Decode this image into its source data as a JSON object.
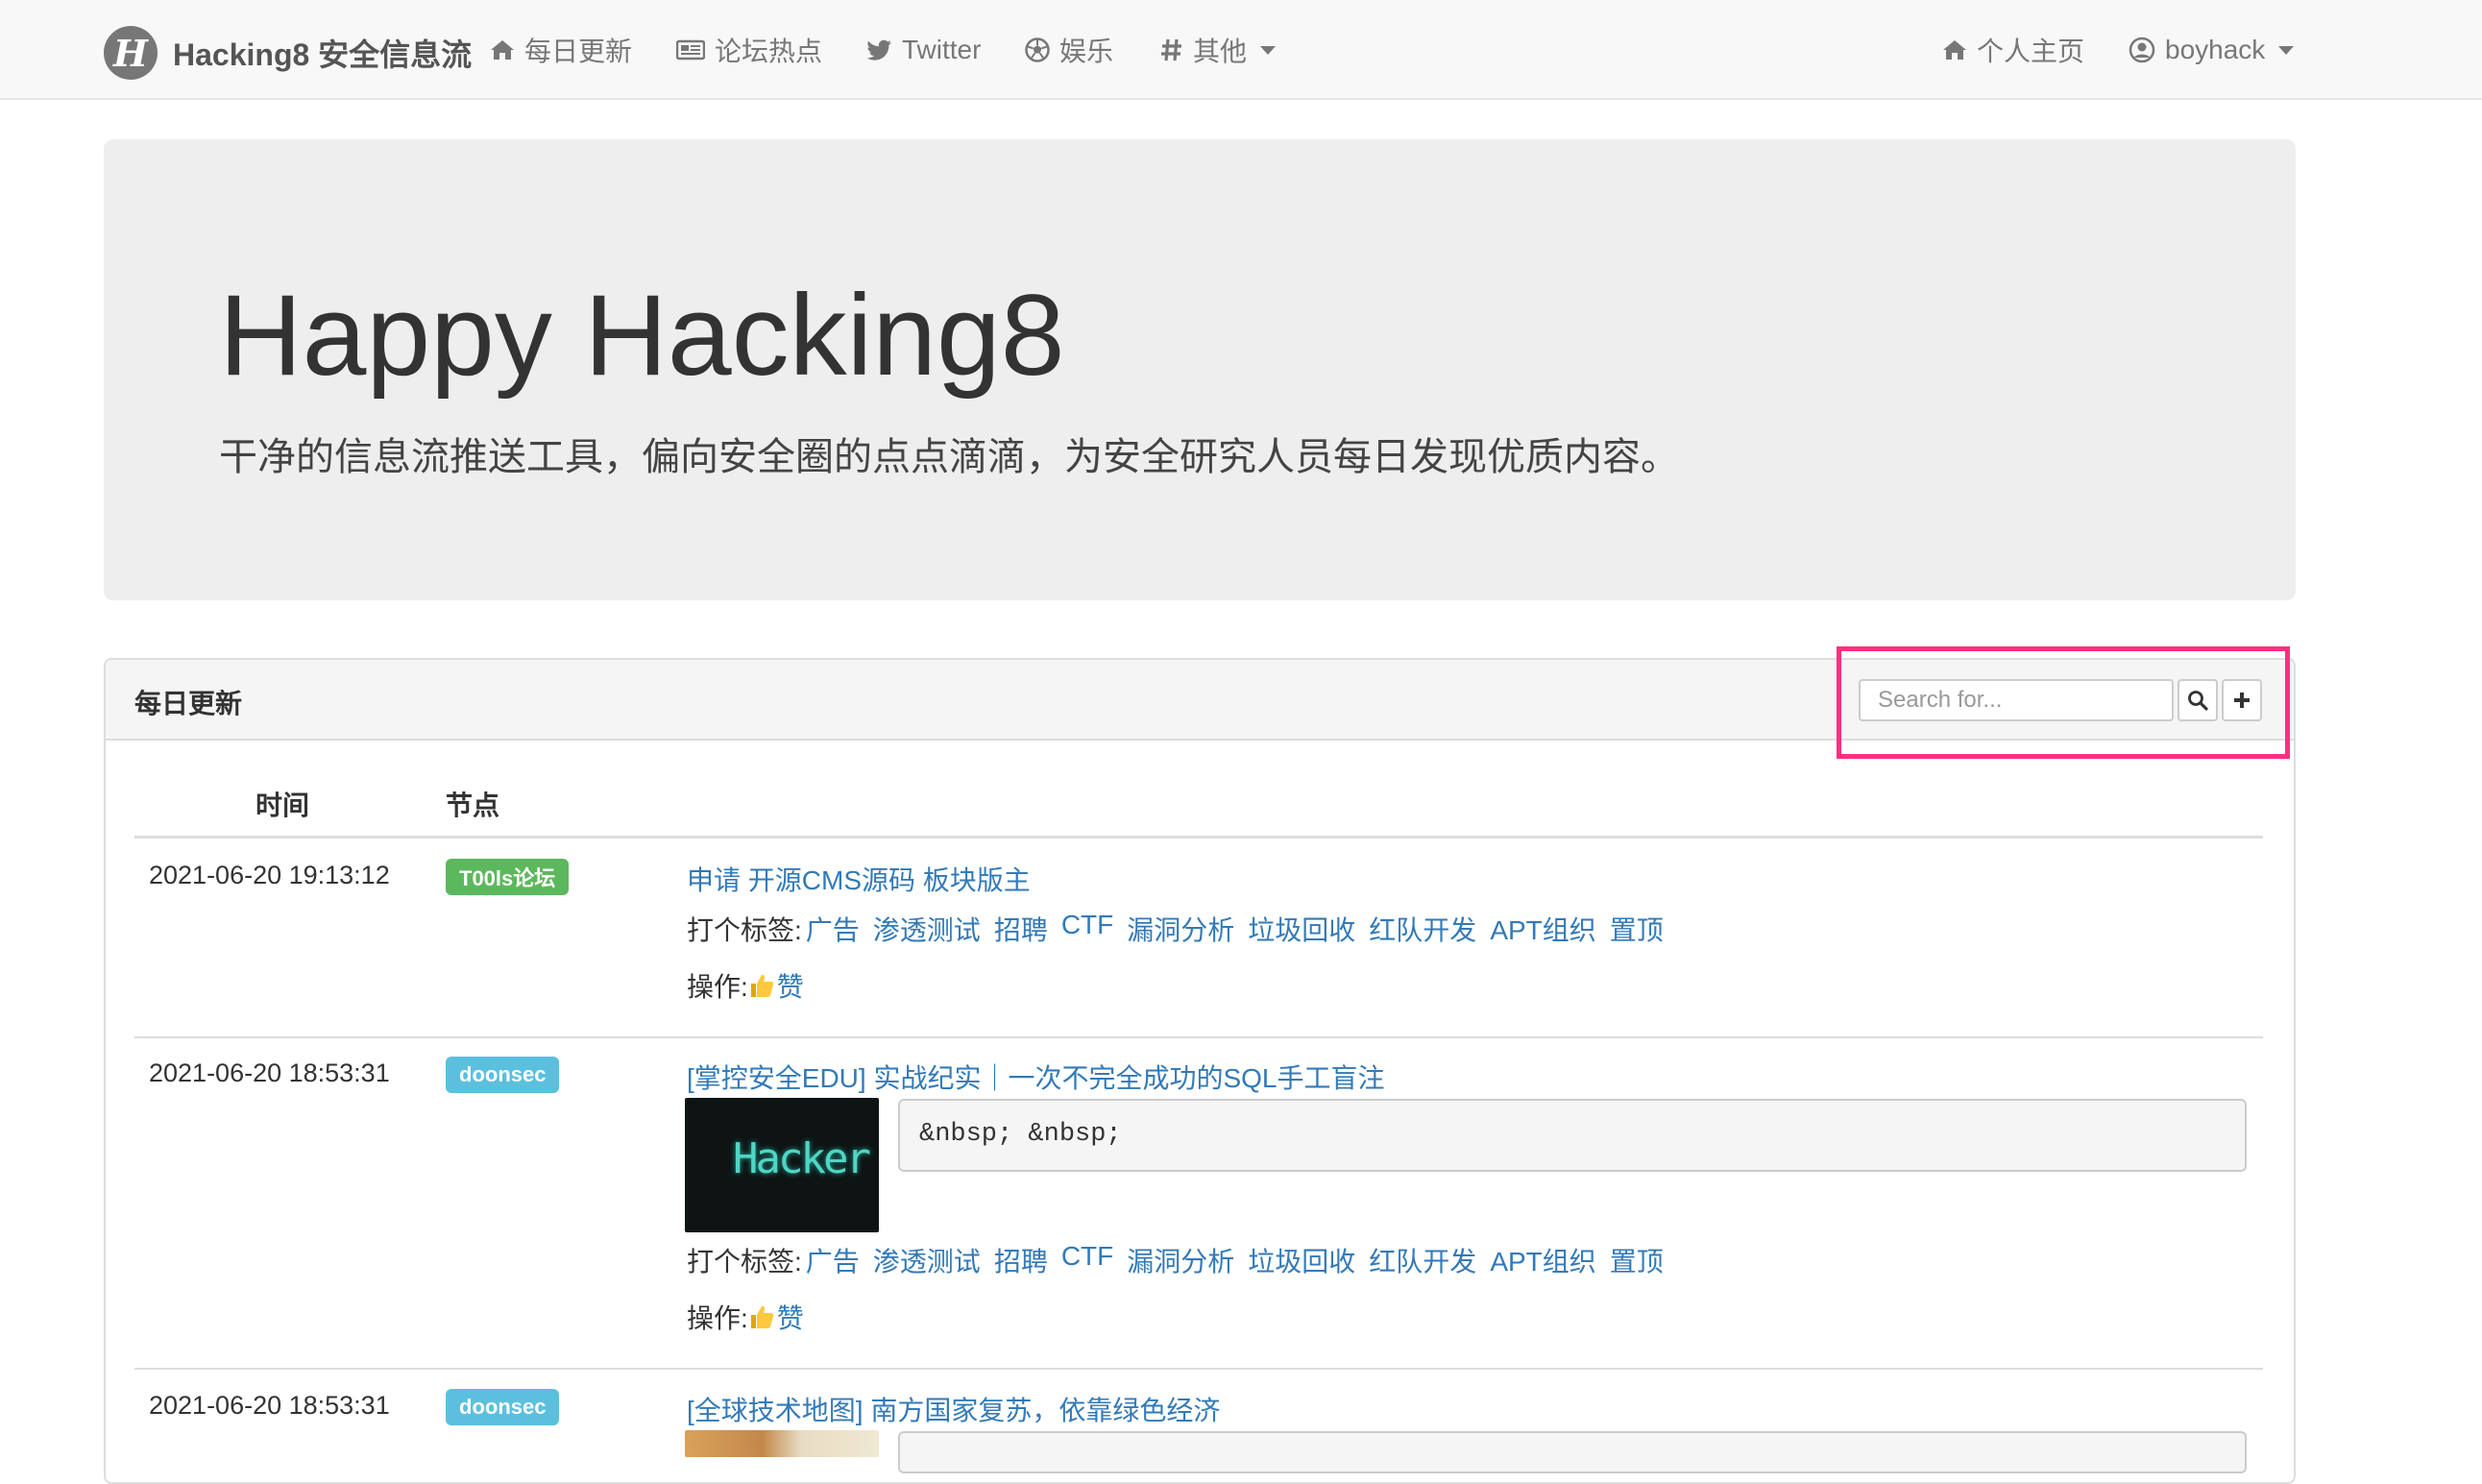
{
  "navbar": {
    "brand": "Hacking8 安全信息流",
    "items": [
      {
        "label": "每日更新",
        "icon": "home-icon"
      },
      {
        "label": "论坛热点",
        "icon": "newspaper-icon"
      },
      {
        "label": "Twitter",
        "icon": "twitter-icon"
      },
      {
        "label": "娱乐",
        "icon": "soccer-ball-icon"
      },
      {
        "label": "其他",
        "icon": "hashtag-icon"
      }
    ],
    "right": {
      "home_label": "个人主页",
      "user_label": "boyhack"
    }
  },
  "jumbotron": {
    "title": "Happy Hacking8",
    "subtitle": "干净的信息流推送工具，偏向安全圈的点点滴滴，为安全研究人员每日发现优质内容。"
  },
  "panel": {
    "title": "每日更新",
    "search_placeholder": "Search for..."
  },
  "table": {
    "headers": {
      "time": "时间",
      "node": "节点"
    },
    "tags_label": "打个标签:",
    "tags": [
      "广告",
      "渗透测试",
      "招聘",
      "CTF",
      "漏洞分析",
      "垃圾回收",
      "红队开发",
      "APT组织",
      "置顶"
    ],
    "ops_label": "操作:",
    "like_label": "赞",
    "rows": [
      {
        "time": "2021-06-20 19:13:12",
        "node": "T00ls论坛",
        "title": "申请 开源CMS源码 板块版主"
      },
      {
        "time": "2021-06-20 18:53:31",
        "node": "doonsec",
        "title": "[掌控安全EDU] 实战纪实｜一次不完全成功的SQL手工盲注",
        "image_text": "Hacker",
        "snippet": "&nbsp; &nbsp;"
      },
      {
        "time": "2021-06-20 18:53:31",
        "node": "doonsec",
        "title": "[全球技术地图] 南方国家复苏，依靠绿色经济"
      }
    ]
  },
  "colors": {
    "link": "#337ab7",
    "badge_green": "#5cb85c",
    "badge_blue": "#5bc0de",
    "highlight": "#ff2f80"
  }
}
